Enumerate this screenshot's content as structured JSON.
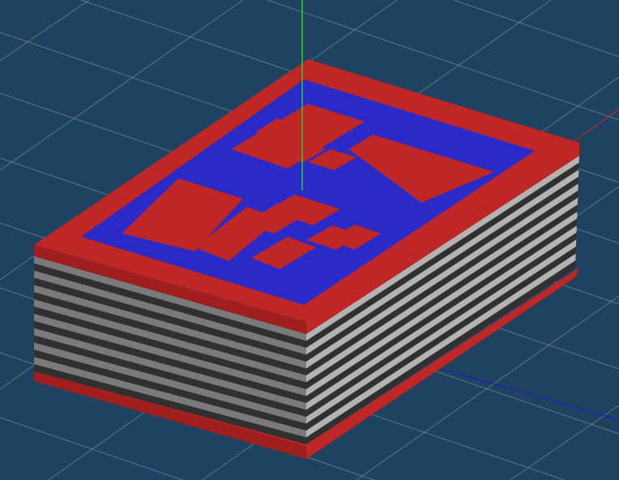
{
  "viewport": {
    "background": "#1f4260",
    "grid_color": "#8fa6a6"
  },
  "axes": {
    "x_color": "#d02a2a",
    "y_color": "#1a1ad0",
    "z_color": "#2ad02a"
  },
  "model": {
    "object": "box",
    "cover_color": "#bf2626",
    "inset_color": "#2a2ac8",
    "stripe_light": "#b3b3b3",
    "stripe_mid": "#7a7a7a",
    "stripe_dark": "#303030",
    "cover_edge": "#a11e1e",
    "stripe_count": 8
  }
}
